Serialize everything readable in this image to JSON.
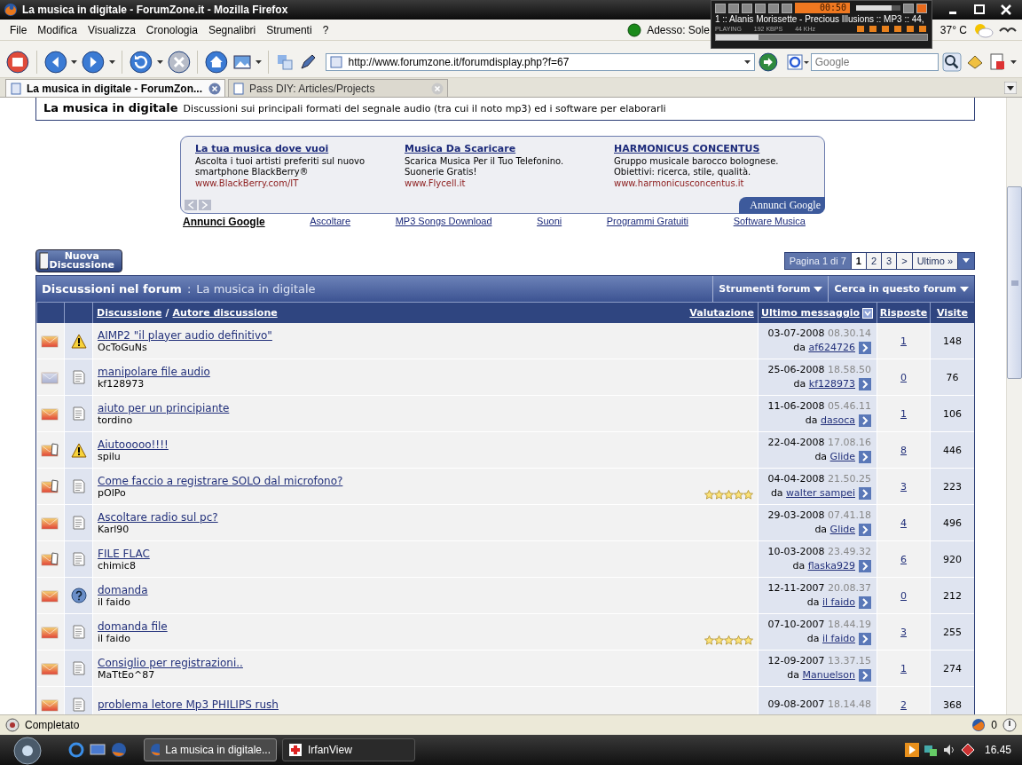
{
  "window": {
    "title": "La musica in digitale - ForumZone.it - Mozilla Firefox"
  },
  "player": {
    "time": "00:50",
    "track": "1 :: Alanis Morissette - Precious Illusions :: MP3 :: 44,",
    "status": "PLAYING",
    "bitrate": "192 KBPS",
    "samplerate": "44 KHz",
    "volume": {
      "level": 0.8
    },
    "seek": {
      "level": 0.2
    }
  },
  "menu": [
    "File",
    "Modifica",
    "Visualizza",
    "Cronologia",
    "Segnalibri",
    "Strumenti",
    "?"
  ],
  "weather": {
    "text": "Adesso: Sole",
    "temperature": "37° C"
  },
  "address": "http://www.forumzone.it/forumdisplay.php?f=67",
  "search": {
    "placeholder": "Google"
  },
  "tabs": [
    {
      "label": "La musica in digitale - ForumZon...",
      "selected": true
    },
    {
      "label": "Pass DIY: Articles/Projects",
      "selected": false
    }
  ],
  "forum": {
    "title": "La musica in digitale",
    "description": "Discussioni sui principali formati del segnale audio (tra cui il noto mp3) ed i software per elaborarli"
  },
  "ads": [
    {
      "title": "La tua musica dove vuoi",
      "lines": [
        "Ascolta i tuoi artisti preferiti sul nuovo",
        "smartphone BlackBerry®"
      ],
      "url": "www.BlackBerry.com/IT"
    },
    {
      "title": "Musica Da Scaricare",
      "lines": [
        "Scarica Musica Per il Tuo Telefonino.",
        "Suonerie Gratis!"
      ],
      "url": "www.Flycell.it"
    },
    {
      "title": "HARMONICUS CONCENTUS",
      "lines": [
        "Gruppo musicale barocco bolognese.",
        "Obiettivi: ricerca, stile, qualità."
      ],
      "url": "www.harmonicusconcentus.it"
    }
  ],
  "ads_badge": "Annunci Google",
  "ad_links": {
    "label": "Annunci Google",
    "links": [
      "Ascoltare",
      "MP3 Songs Download",
      "Suoni",
      "Programmi Gratuiti",
      "Software Musica"
    ]
  },
  "new_thread_button": "Nuova Discussione",
  "pagination": {
    "label": "Pagina 1 di 7",
    "pages": [
      {
        "label": "1",
        "selected": true
      },
      {
        "label": "2",
        "selected": false
      },
      {
        "label": "3",
        "selected": false
      }
    ],
    "next": ">",
    "last": "Ultimo »"
  },
  "thread_list": {
    "title": "Discussioni nel forum",
    "separator": ":",
    "subtitle": "La musica in digitale",
    "tools": [
      "Strumenti forum",
      "Cerca in questo forum"
    ]
  },
  "columns": {
    "thread": "Discussione",
    "separator": "/",
    "author": "Autore discussione",
    "rating": "Valutazione",
    "last_post": "Ultimo messaggio",
    "replies": "Risposte",
    "views": "Visite"
  },
  "threads": [
    {
      "status": {
        "kind": "new"
      },
      "icon": {
        "kind": "warning"
      },
      "title": "AIMP2 \"il player audio definitivo\"",
      "author": "OcToGuNs",
      "date": "03-07-2008",
      "time": "08.30.14",
      "by": "da",
      "last_by": "af624726",
      "replies": "1",
      "views": "148"
    },
    {
      "status": {
        "kind": "read"
      },
      "icon": {
        "kind": "document"
      },
      "title": "manipolare file audio",
      "author": "kf128973",
      "date": "25-06-2008",
      "time": "18.58.50",
      "by": "da",
      "last_by": "kf128973",
      "replies": "0",
      "views": "76"
    },
    {
      "status": {
        "kind": "new"
      },
      "icon": {
        "kind": "document"
      },
      "title": "aiuto per un principiante",
      "author": "tordino",
      "date": "11-06-2008",
      "time": "05.46.11",
      "by": "da",
      "last_by": "dasoca",
      "replies": "1",
      "views": "106"
    },
    {
      "status": {
        "kind": "posted"
      },
      "icon": {
        "kind": "warning"
      },
      "title": "Aiutooooo!!!!",
      "author": "spilu",
      "date": "22-04-2008",
      "time": "17.08.16",
      "by": "da",
      "last_by": "Glide",
      "replies": "8",
      "views": "446"
    },
    {
      "status": {
        "kind": "posted"
      },
      "icon": {
        "kind": "document"
      },
      "title": "Come faccio a registrare SOLO dal microfono?",
      "author": "pOlPo",
      "stars": 5,
      "date": "04-04-2008",
      "time": "21.50.25",
      "by": "da",
      "last_by": "walter sampei",
      "replies": "3",
      "views": "223"
    },
    {
      "status": {
        "kind": "new"
      },
      "icon": {
        "kind": "document"
      },
      "title": "Ascoltare radio sul pc?",
      "author": "Karl90",
      "date": "29-03-2008",
      "time": "07.41.18",
      "by": "da",
      "last_by": "Glide",
      "replies": "4",
      "views": "496"
    },
    {
      "status": {
        "kind": "posted"
      },
      "icon": {
        "kind": "document"
      },
      "title": "FILE FLAC",
      "author": "chimic8",
      "date": "10-03-2008",
      "time": "23.49.32",
      "by": "da",
      "last_by": "flaska929",
      "replies": "6",
      "views": "920"
    },
    {
      "status": {
        "kind": "new"
      },
      "icon": {
        "kind": "question"
      },
      "title": "domanda",
      "author": "il faido",
      "date": "12-11-2007",
      "time": "20.08.37",
      "by": "da",
      "last_by": "il faido",
      "replies": "0",
      "views": "212"
    },
    {
      "status": {
        "kind": "new"
      },
      "icon": {
        "kind": "document"
      },
      "title": "domanda file",
      "author": "il faido",
      "stars": 5,
      "date": "07-10-2007",
      "time": "18.44.19",
      "by": "da",
      "last_by": "il faido",
      "replies": "3",
      "views": "255"
    },
    {
      "status": {
        "kind": "new"
      },
      "icon": {
        "kind": "document"
      },
      "title": "Consiglio per registrazioni..",
      "author": "MaTtEo^87",
      "date": "12-09-2007",
      "time": "13.37.15",
      "by": "da",
      "last_by": "Manuelson",
      "replies": "1",
      "views": "274"
    },
    {
      "status": {
        "kind": "new"
      },
      "icon": {
        "kind": "document"
      },
      "title": "problema letore Mp3 PHILIPS rush",
      "date": "09-08-2007",
      "time": "18.14.48",
      "replies": "2",
      "views": "368"
    }
  ],
  "status_bar": {
    "text": "Completato",
    "count": "0"
  },
  "taskbar": {
    "tasks": [
      {
        "label": "La musica in digitale...",
        "selected": true
      },
      {
        "label": "IrfanView",
        "selected": false
      }
    ],
    "clock": "16.45"
  }
}
